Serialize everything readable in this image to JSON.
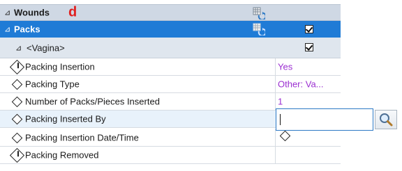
{
  "tree": {
    "wounds": {
      "label": "Wounds",
      "expand": "⊿",
      "marker": "d"
    },
    "packs": {
      "label": "Packs",
      "expand": "⊿"
    },
    "vagina": {
      "label": "<Vagina>",
      "expand": "⊿"
    }
  },
  "rows": [
    {
      "label": "Packing Insertion",
      "value": "Yes",
      "required": true
    },
    {
      "label": "Packing Type",
      "value": "Other: Va...",
      "required": false
    },
    {
      "label": "Number of Packs/Pieces Inserted",
      "value": "1",
      "required": false
    },
    {
      "label": "Packing Inserted By",
      "value": "",
      "required": false,
      "editing": true
    },
    {
      "label": "Packing Insertion Date/Time",
      "value": "",
      "required": false
    },
    {
      "label": "Packing Removed",
      "value": "",
      "required": true
    }
  ],
  "colors": {
    "selected_header": "#1f7bd6",
    "value_text": "#9b2fd1",
    "marker": "#e02020"
  },
  "icons": {
    "grid_icon": "grid-refresh-icon",
    "search_icon": "magnifier-icon"
  }
}
